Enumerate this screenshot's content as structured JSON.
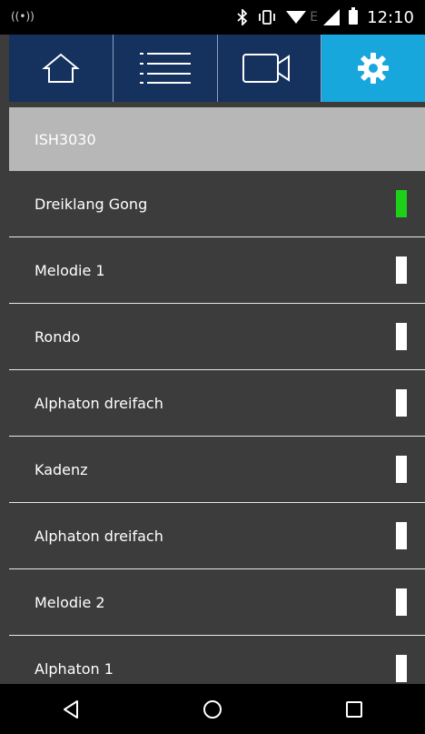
{
  "status_bar": {
    "left_icon": "radio-icon",
    "bluetooth_icon": "bluetooth-icon",
    "vibrate_icon": "vibrate-icon",
    "wifi_icon": "wifi-icon",
    "network_label": "E",
    "signal_icon": "signal-icon",
    "battery_icon": "battery-icon",
    "time": "12:10"
  },
  "nav": {
    "items": [
      {
        "name": "home",
        "icon": "home-icon"
      },
      {
        "name": "list",
        "icon": "list-icon"
      },
      {
        "name": "video",
        "icon": "video-camera-icon"
      },
      {
        "name": "settings",
        "icon": "gear-icon",
        "active": true
      }
    ],
    "active_color": "#18a7dd",
    "bg_color": "#15315e"
  },
  "device": {
    "name": "ISH3030"
  },
  "ringtones": [
    {
      "label": "Dreiklang Gong",
      "selected": true
    },
    {
      "label": "Melodie 1",
      "selected": false
    },
    {
      "label": "Rondo",
      "selected": false
    },
    {
      "label": "Alphaton dreifach",
      "selected": false
    },
    {
      "label": "Kadenz",
      "selected": false
    },
    {
      "label": "Alphaton dreifach",
      "selected": false
    },
    {
      "label": "Melodie 2",
      "selected": false
    },
    {
      "label": "Alphaton 1",
      "selected": false
    }
  ],
  "colors": {
    "selected_indicator": "#1fd01a",
    "unselected_indicator": "#ffffff",
    "row_bg": "#3c3c3c"
  },
  "bottom_nav": {
    "back_icon": "back-triangle-icon",
    "home_icon": "home-circle-icon",
    "recents_icon": "recents-square-icon"
  }
}
